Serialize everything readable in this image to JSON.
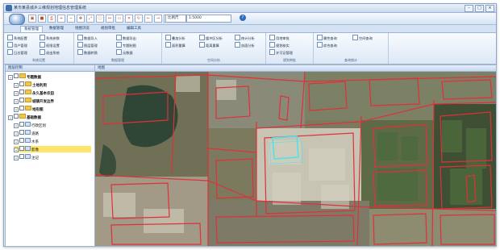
{
  "window": {
    "title": "某市某县城乡三维规划地理信息管理系统",
    "controls": [
      "–",
      "□",
      "×"
    ]
  },
  "quick_access": {
    "icons": [
      "open-icon",
      "save-icon",
      "print-icon",
      "zoom-in-icon",
      "zoom-out-icon",
      "pan-icon",
      "full-extent-icon",
      "identify-icon",
      "measure-icon",
      "select-icon",
      "clear-icon",
      "refresh-icon",
      "back-icon",
      "forward-icon",
      "layers-icon",
      "table-icon",
      "search-icon",
      "help-icon"
    ],
    "scale_label": "比例尺",
    "scale_value": "1:5000",
    "help_label": "?"
  },
  "tabs": [
    "系统管理",
    "数据管理",
    "地图浏览",
    "规划审批",
    "编辑工具"
  ],
  "ribbon": {
    "groups": [
      {
        "label": "系统设置",
        "buttons": [
          "系统配置",
          "系统参数",
          "用户管理",
          "权限设置",
          "日志管理",
          "退出系统"
        ]
      },
      {
        "label": "数据管理",
        "buttons": [
          "数据导入",
          "数据导出",
          "图层管理",
          "专题制图",
          "数据转换",
          "元数据"
        ]
      },
      {
        "label": "空间分析",
        "buttons": [
          "叠加分析",
          "缓冲区分析",
          "统计分析",
          "面积量算",
          "距离量算",
          "剖面分析"
        ]
      },
      {
        "label": "规划审批",
        "buttons": [
          "用地审批",
          "规划核实",
          "许可证管理"
        ]
      },
      {
        "label": "查询统计",
        "buttons": [
          "属性查询",
          "空间查询",
          "综合查询"
        ]
      }
    ]
  },
  "sidebar": {
    "header": "图层控制",
    "items": [
      {
        "label": "专题数据",
        "level": 0
      },
      {
        "label": "土地利用",
        "level": 1
      },
      {
        "label": "永久基本农田",
        "level": 1
      },
      {
        "label": "城镇开发边界",
        "level": 1
      },
      {
        "label": "地形图",
        "level": 1
      },
      {
        "label": "基础数据",
        "level": 0
      },
      {
        "label": "行政区划",
        "level": 1
      },
      {
        "label": "道路",
        "level": 1
      },
      {
        "label": "水系",
        "level": 1
      },
      {
        "label": "影像",
        "level": 1
      },
      {
        "label": "注记",
        "level": 1
      }
    ]
  },
  "map_panel": {
    "header": "地图"
  },
  "colors": {
    "parcel_outline": "#e0303a",
    "selection_outline": "#3fe6f2",
    "ribbon_bg": "#dde8f5",
    "selected_item": "#ffe46a"
  }
}
